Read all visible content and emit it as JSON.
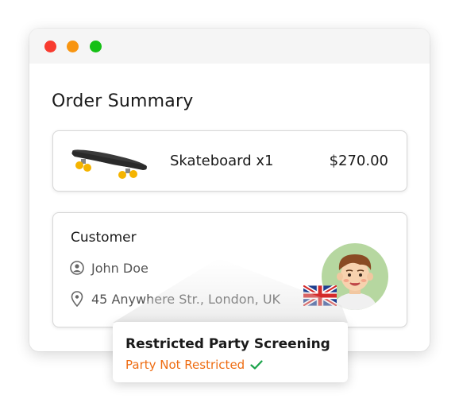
{
  "window": {
    "controls": [
      "close",
      "minimize",
      "maximize"
    ]
  },
  "order": {
    "title": "Order Summary",
    "product": {
      "name": "Skateboard x1",
      "price": "$270.00",
      "icon": "skateboard-image"
    }
  },
  "customer": {
    "title": "Customer",
    "name": "John Doe",
    "address": "45 Anywhere Str., London, UK",
    "name_icon": "user-icon",
    "address_icon": "location-pin-icon",
    "flag": "uk-flag",
    "avatar": "avatar-portrait"
  },
  "screening": {
    "title": "Restricted Party Screening",
    "status": "Party Not Restricted",
    "status_color": "#ee6c12",
    "check_color": "#1aa34a"
  },
  "colors": {
    "close": "#f83b2f",
    "minimize": "#f89511",
    "maximize": "#15c015"
  }
}
